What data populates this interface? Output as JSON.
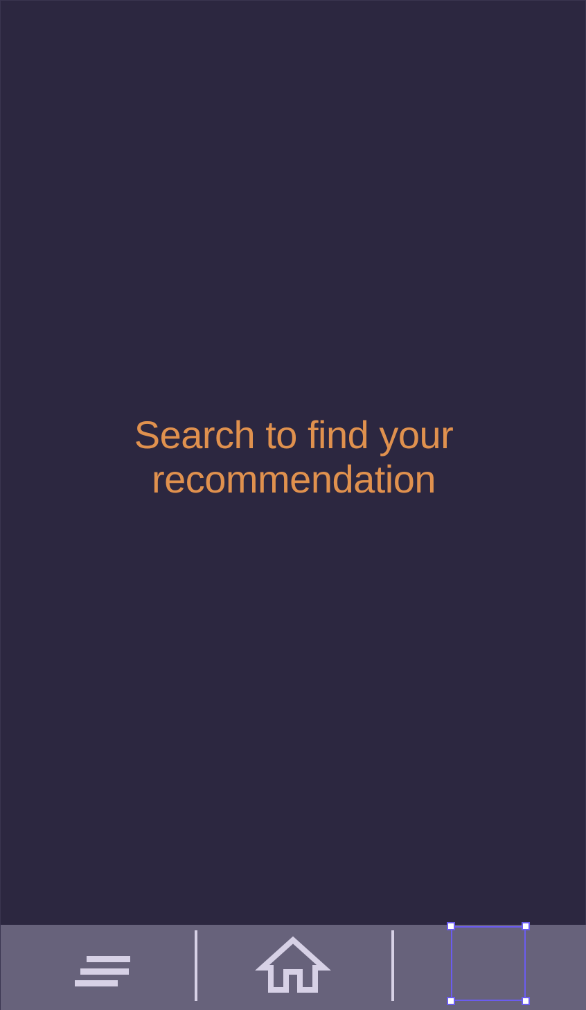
{
  "main": {
    "empty_message": "Search to find your recommendation"
  },
  "bottom_nav": {
    "items": [
      {
        "name": "menu",
        "icon": "menu-lines-icon"
      },
      {
        "name": "home",
        "icon": "home-icon"
      },
      {
        "name": "selection",
        "icon": "selection-frame-icon"
      }
    ]
  },
  "colors": {
    "background": "#2c2740",
    "bottom_bar": "#67627b",
    "message_text": "#e0914e",
    "icon": "#d7d1e6",
    "selection_accent": "#6b5cf0"
  }
}
